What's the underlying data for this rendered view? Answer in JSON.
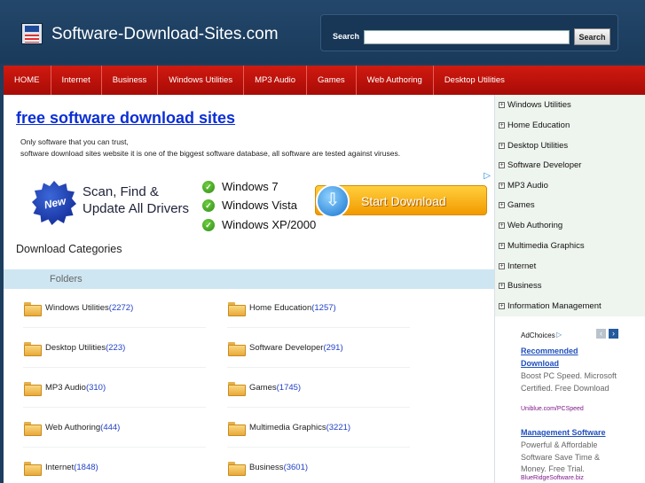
{
  "header": {
    "site_title": "Software-Download-Sites.com",
    "search": {
      "label": "Search",
      "placeholder": "",
      "value": "",
      "button": "Search"
    }
  },
  "nav": [
    "HOME",
    "Internet",
    "Business",
    "Windows Utilities",
    "MP3 Audio",
    "Games",
    "Web Authoring",
    "Desktop Utilities"
  ],
  "main": {
    "title": "free software download sites",
    "intro_line1": "Only software that you can trust,",
    "intro_line2": "software download sites website it is one of the biggest software database, all software are tested against viruses.",
    "ad": {
      "badge": "New",
      "headline1": "Scan, Find &",
      "headline2": "Update All Drivers",
      "os_list": [
        "Windows 7",
        "Windows Vista",
        "Windows XP/2000"
      ],
      "button": "Start Download"
    },
    "categories_heading": "Download Categories",
    "folders_label": "Folders",
    "categories": [
      {
        "name": "Windows Utilities",
        "count": "(2272)"
      },
      {
        "name": "Home Education",
        "count": "(1257)"
      },
      {
        "name": "Desktop Utilities",
        "count": "(223)"
      },
      {
        "name": "Software Developer",
        "count": "(291)"
      },
      {
        "name": "MP3 Audio",
        "count": "(310)"
      },
      {
        "name": "Games",
        "count": "(1745)"
      },
      {
        "name": "Web Authoring",
        "count": "(444)"
      },
      {
        "name": "Multimedia Graphics",
        "count": "(3221)"
      },
      {
        "name": "Internet",
        "count": "(1848)"
      },
      {
        "name": "Business",
        "count": "(3601)"
      }
    ]
  },
  "sidebar": {
    "items": [
      "Windows Utilities",
      "Home Education",
      "Desktop Utilities",
      "Software Developer",
      "MP3 Audio",
      "Games",
      "Web Authoring",
      "Multimedia Graphics",
      "Internet",
      "Business",
      "Information Management"
    ],
    "ads": {
      "adchoices": "AdChoices",
      "items": [
        {
          "title_line1": "Recommended",
          "title_line2": "Download",
          "body": "Boost PC Speed. Microsoft Certified. Free Download",
          "url": "Uniblue.com/PCSpeed"
        },
        {
          "title_line1": "Management Software",
          "body": "Powerful & Affordable Software Save Time & Money. Free Trial.",
          "url": "BlueRidgeSoftware.biz"
        }
      ]
    }
  }
}
